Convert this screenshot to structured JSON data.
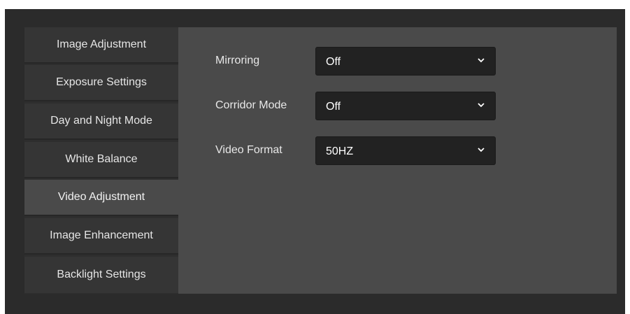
{
  "sidebar": {
    "items": [
      {
        "label": "Image Adjustment",
        "active": false
      },
      {
        "label": "Exposure Settings",
        "active": false
      },
      {
        "label": "Day and Night Mode",
        "active": false
      },
      {
        "label": "White Balance",
        "active": false
      },
      {
        "label": "Video Adjustment",
        "active": true
      },
      {
        "label": "Image Enhancement",
        "active": false
      },
      {
        "label": "Backlight Settings",
        "active": false
      }
    ]
  },
  "settings": {
    "mirroring": {
      "label": "Mirroring",
      "value": "Off"
    },
    "corridor_mode": {
      "label": "Corridor Mode",
      "value": "Off"
    },
    "video_format": {
      "label": "Video Format",
      "value": "50HZ"
    }
  },
  "icons": {
    "dropdown": "chevron-down-icon"
  },
  "colors": {
    "frame": "#2b2b2b",
    "sidebar_item": "#353535",
    "sidebar_active": "#4a4a4a",
    "content": "#4a4a4a",
    "select_bg": "#222222",
    "text": "#e6e6e6"
  }
}
